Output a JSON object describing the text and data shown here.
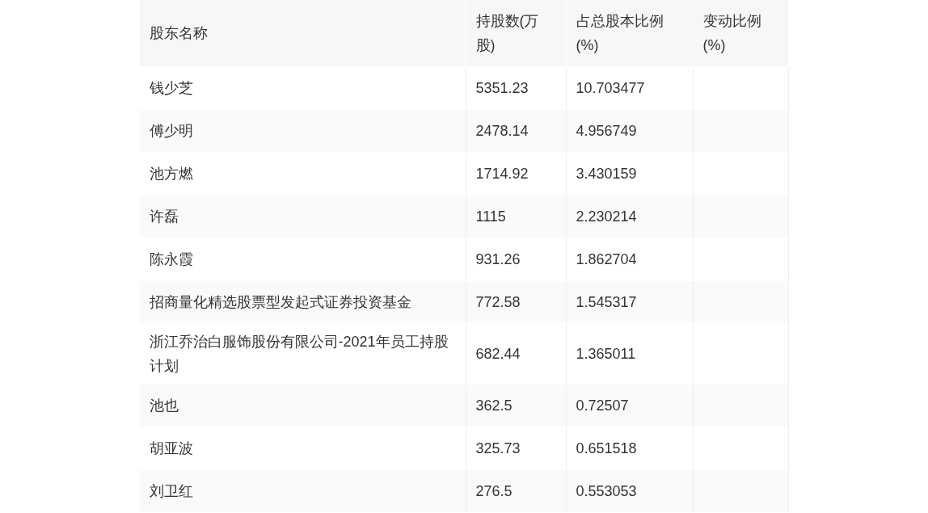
{
  "table": {
    "columns": [
      "股东名称",
      "持股数(万股)",
      "占总股本比例(%)",
      "变动比例(%)"
    ],
    "rows": [
      [
        "钱少芝",
        "5351.23",
        "10.703477"
      ],
      [
        "傅少明",
        "2478.14",
        "4.956749"
      ],
      [
        "池方燃",
        "1714.92",
        "3.430159"
      ],
      [
        "许磊",
        "1115",
        "2.230214"
      ],
      [
        "陈永霞",
        "931.26",
        "1.862704"
      ],
      [
        "招商量化精选股票型发起式证券投资基金",
        "772.58",
        "1.545317"
      ],
      [
        "浙江乔治白服饰股份有限公司-2021年员工持股计划",
        "682.44",
        "1.365011"
      ],
      [
        "池也",
        "362.5",
        "0.72507"
      ],
      [
        "胡亚波",
        "325.73",
        "0.651518"
      ],
      [
        "刘卫红",
        "276.5",
        "0.553053"
      ]
    ]
  }
}
